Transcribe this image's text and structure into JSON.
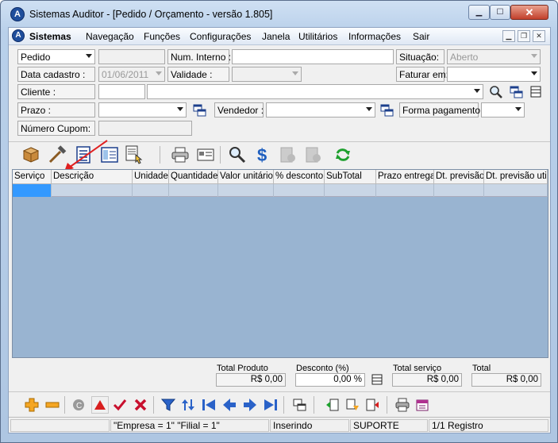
{
  "window": {
    "title": "Sistemas Auditor - [Pedido / Orçamento - versão 1.805]",
    "app_icon_letter": "A"
  },
  "menu": {
    "brand": "Sistemas",
    "items": [
      "Navegação",
      "Funções",
      "Configurações",
      "Janela",
      "Utilitários",
      "Informações",
      "Sair"
    ]
  },
  "form": {
    "tipo": {
      "value": "Pedido"
    },
    "num_interno": {
      "label": "Num. Interno :",
      "value": ""
    },
    "situacao": {
      "label": "Situação:",
      "value": "Aberto"
    },
    "data_cadastro": {
      "label": "Data cadastro :",
      "value": "01/06/2011"
    },
    "validade": {
      "label": "Validade :",
      "value": ""
    },
    "faturar_em": {
      "label": "Faturar em:",
      "value": ""
    },
    "cliente": {
      "label": "Cliente :",
      "code": "",
      "name": ""
    },
    "prazo": {
      "label": "Prazo :",
      "value": ""
    },
    "vendedor": {
      "label": "Vendedor :",
      "value": ""
    },
    "forma_pagamento": {
      "label": "Forma pagamento:",
      "value": ""
    },
    "numero_cupom": {
      "label": "Número Cupom:",
      "value": ""
    }
  },
  "grid": {
    "columns": [
      "Serviço",
      "Descrição",
      "Unidade",
      "Quantidade",
      "Valor unitário",
      "% desconto",
      "SubTotal",
      "Prazo entrega",
      "Dt. previsão",
      "Dt. previsão util"
    ]
  },
  "totals": {
    "total_produto": {
      "label": "Total Produto",
      "value": "R$ 0,00"
    },
    "desconto": {
      "label": "Desconto (%)",
      "value": "0,00 %"
    },
    "total_servico": {
      "label": "Total serviço",
      "value": "R$ 0,00"
    },
    "total": {
      "label": "Total",
      "value": "R$ 0,00"
    }
  },
  "status": {
    "empresa": "\"Empresa = 1\"   \"Filial = 1\"",
    "mode": "Inserindo",
    "user": "SUPORTE",
    "records": "1/1 Registro"
  },
  "colors": {
    "grid_bg": "#99b4d1",
    "selected_cell": "#3399ff",
    "annotation_arrow": "#e02020"
  }
}
